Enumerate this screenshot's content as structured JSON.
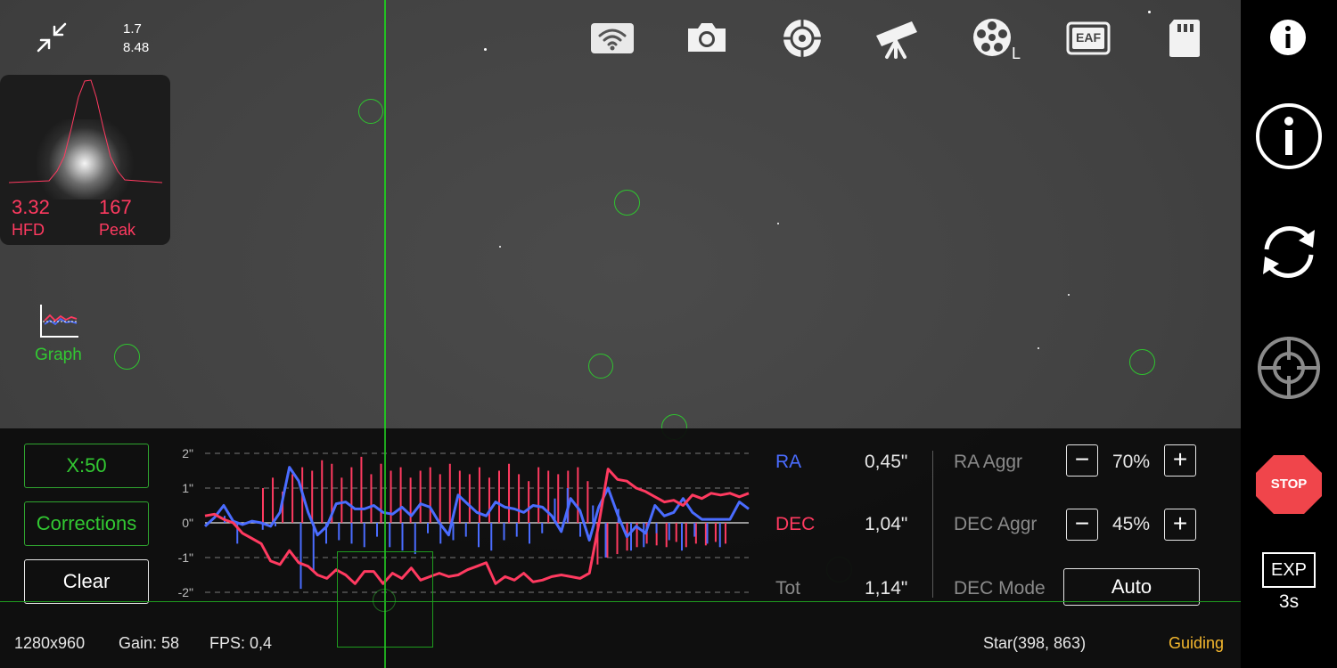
{
  "header": {
    "line1": "1.7",
    "line2": "8.48"
  },
  "star_profile": {
    "hfd_value": "3.32",
    "hfd_label": "HFD",
    "peak_value": "167",
    "peak_label": "Peak"
  },
  "graph_button": {
    "label": "Graph"
  },
  "top_toolbar": {
    "icons": [
      "wifi-icon",
      "camera-icon",
      "guide-target-icon",
      "telescope-icon",
      "filter-wheel-icon",
      "eaf-icon",
      "sd-card-icon"
    ],
    "eaf_text": "EAF",
    "filter_suffix": "L"
  },
  "guide_panel": {
    "scale_button": "X:50",
    "corrections_button": "Corrections",
    "clear_button": "Clear",
    "y_ticks": [
      "2\"",
      "1\"",
      "0\"",
      "-1\"",
      "-2\""
    ],
    "ra_label": "RA",
    "ra_value": "0,45\"",
    "dec_label": "DEC",
    "dec_value": "1,04\"",
    "tot_label": "Tot",
    "tot_value": "1,14\"",
    "ra_aggr_label": "RA Aggr",
    "ra_aggr_value": "70%",
    "dec_aggr_label": "DEC Aggr",
    "dec_aggr_value": "45%",
    "dec_mode_label": "DEC Mode",
    "dec_mode_value": "Auto",
    "minus": "−",
    "plus": "+"
  },
  "chart_data": {
    "type": "line",
    "ylim": [
      -2,
      2
    ],
    "series": [
      {
        "name": "RA",
        "color": "#4a6cff",
        "values": [
          -0.1,
          0.15,
          0.5,
          0.05,
          -0.05,
          0.05,
          0.0,
          -0.1,
          0.3,
          1.6,
          1.2,
          0.3,
          -0.35,
          -0.1,
          0.55,
          0.6,
          0.4,
          0.4,
          0.5,
          0.3,
          0.25,
          0.45,
          0.2,
          0.55,
          0.45,
          0.0,
          -0.35,
          0.8,
          0.55,
          0.3,
          0.2,
          0.6,
          0.45,
          0.4,
          0.3,
          0.5,
          0.45,
          0.2,
          -0.25,
          0.7,
          0.35,
          -0.5,
          0.45,
          1.0,
          0.25,
          -0.4,
          -0.1,
          -0.3,
          0.5,
          0.2,
          0.3,
          0.7,
          0.3,
          0.1,
          0.1,
          0.1,
          0.1,
          0.6,
          0.4
        ]
      },
      {
        "name": "DEC",
        "color": "#ff3a60",
        "values": [
          0.2,
          0.25,
          0.1,
          0.0,
          -0.3,
          -0.45,
          -0.6,
          -1.1,
          -1.2,
          -0.8,
          -1.15,
          -1.25,
          -1.5,
          -1.6,
          -1.35,
          -1.5,
          -1.75,
          -1.4,
          -1.4,
          -1.75,
          -1.45,
          -1.6,
          -1.3,
          -1.65,
          -1.55,
          -1.45,
          -1.55,
          -1.5,
          -1.35,
          -1.25,
          -1.15,
          -1.75,
          -1.55,
          -1.65,
          -1.45,
          -1.7,
          -1.65,
          -1.55,
          -1.5,
          -1.55,
          -1.6,
          -1.45,
          -0.05,
          1.55,
          1.25,
          1.2,
          1.0,
          0.9,
          0.75,
          0.6,
          0.65,
          0.5,
          0.8,
          0.7,
          0.85,
          0.8,
          0.85,
          0.75,
          0.85
        ]
      }
    ],
    "bars": {
      "ra": [
        0.2,
        -0.6,
        0.0,
        -0.2,
        -0.1,
        0.0,
        -1.9,
        -1.4,
        -0.6,
        -0.5,
        -0.6,
        -0.7,
        -0.4,
        -0.7,
        -0.8,
        -0.9,
        -0.3,
        -0.6,
        -0.5,
        -0.4,
        -0.7,
        -0.8,
        -0.5,
        -0.4,
        -0.6,
        -0.3,
        0.7,
        1.0,
        -0.4,
        0.5,
        -1.0,
        0.4,
        -0.8,
        -0.7,
        -0.3,
        -0.5,
        -0.8,
        -0.4,
        -0.6,
        -0.7
      ],
      "dec": [
        1.0,
        1.3,
        0.9,
        1.4,
        1.6,
        1.5,
        1.8,
        1.7,
        1.3,
        1.6,
        1.9,
        1.4,
        1.7,
        1.5,
        1.6,
        1.3,
        1.5,
        1.6,
        1.4,
        1.7,
        1.5,
        1.4,
        1.6,
        1.3,
        1.5,
        1.7,
        1.4,
        1.2,
        1.6,
        1.5,
        1.4,
        1.5,
        1.6,
        1.2,
        -1.2,
        -1.0,
        -0.9,
        -0.8,
        -0.7,
        -0.6,
        -0.65,
        -0.7,
        -0.55,
        -0.7,
        -0.6,
        -0.65,
        -0.55,
        -0.6
      ]
    }
  },
  "right_sidebar": {
    "stop_label": "STOP",
    "exp_label": "EXP",
    "exp_value": "3s"
  },
  "status_bar": {
    "resolution": "1280x960",
    "gain": "Gain: 58",
    "fps": "FPS: 0,4",
    "star_pos": "Star(398, 863)",
    "state": "Guiding"
  },
  "colors": {
    "accent_green": "#2fc42f",
    "ra_blue": "#4a6cff",
    "dec_red": "#ff3a60",
    "guiding_yellow": "#f5b82e",
    "stop_red": "#f0454b"
  }
}
